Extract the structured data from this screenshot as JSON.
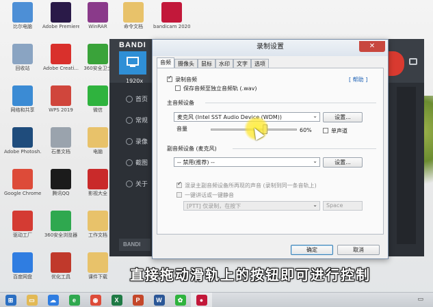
{
  "desktop": {
    "icons": [
      {
        "label": "比尔电脑",
        "icon": "computer-icon",
        "color": "#4d8fd6"
      },
      {
        "label": "Adobe Premiere...",
        "icon": "premiere-icon",
        "color": "#2a1a48"
      },
      {
        "label": "WinRAR",
        "icon": "winrar-icon",
        "color": "#8a3a8a"
      },
      {
        "label": "命令文档",
        "icon": "folder-icon",
        "color": "#e8c26a"
      },
      {
        "label": "bandicam 2020-03-0...",
        "icon": "video-file-icon",
        "color": "#c2183a"
      },
      {
        "label": "回收站",
        "icon": "recycle-bin-icon",
        "color": "#8aa4c2"
      },
      {
        "label": "Adobe Creati...",
        "icon": "creative-cloud-icon",
        "color": "#d9302c"
      },
      {
        "label": "360安全卫士",
        "icon": "360-security-icon",
        "color": "#3aa33a"
      },
      {
        "label": "网络和共享",
        "icon": "network-icon",
        "color": "#3b8bd4"
      },
      {
        "label": "WPS 2019",
        "icon": "wps-icon",
        "color": "#d0463c"
      },
      {
        "label": "微信",
        "icon": "wechat-icon",
        "color": "#2fb33e"
      },
      {
        "label": "Adobe Photosh...",
        "icon": "photoshop-icon",
        "color": "#1f4c7c"
      },
      {
        "label": "石墨文档",
        "icon": "shimo-doc-icon",
        "color": "#9aa3ad"
      },
      {
        "label": "电脑",
        "icon": "folder-icon",
        "color": "#e8c26a"
      },
      {
        "label": "Google Chrome",
        "icon": "chrome-icon",
        "color": "#dd4b39"
      },
      {
        "label": "腾讯QQ",
        "icon": "qq-icon",
        "color": "#1b1b1b"
      },
      {
        "label": "影视大全",
        "icon": "video-app-icon",
        "color": "#c92a2a"
      },
      {
        "label": "驱动工厂",
        "icon": "tool-icon",
        "color": "#d43b33"
      },
      {
        "label": "360安全浏览器",
        "icon": "360-browser-icon",
        "color": "#2fa84f"
      },
      {
        "label": "工作文档",
        "icon": "folder-icon",
        "color": "#e8c26a"
      },
      {
        "label": "百度网盘",
        "icon": "baidu-netdisk-icon",
        "color": "#2f7de1"
      },
      {
        "label": "优化工具",
        "icon": "app-icon",
        "color": "#c0392b"
      },
      {
        "label": "课件下载",
        "icon": "folder-icon",
        "color": "#e8c26a"
      }
    ]
  },
  "bandicam": {
    "brand": "BANDI",
    "resolution": "1920x",
    "side_items": [
      "首页",
      "常规",
      "录像",
      "截图",
      "关于"
    ],
    "bottom_label": "BANDI"
  },
  "dialog": {
    "title": "录制设置",
    "close_glyph": "✕",
    "tabs": [
      "音频",
      "摄像头",
      "鼠标",
      "水印",
      "文字",
      "选项"
    ],
    "active_tab": "音频",
    "record_audio": {
      "label": "录制音频",
      "checked": true
    },
    "separate_track": {
      "label": "保存音频至独立音频轨 (.wav)",
      "checked": false
    },
    "help_link": "[ 帮助 ]",
    "main_device": {
      "group_label": "主音频设备",
      "value": "麦克风 (Intel SST Audio Device (WDM))",
      "settings_button": "设置...",
      "volume_label": "音量",
      "volume_value": "60%",
      "volume_fraction": 0.6,
      "mono_label": "单声道",
      "mono_checked": false
    },
    "secondary_device": {
      "group_label": "副音频设备 (麦克风)",
      "value": "-- 禁用(推荐) --",
      "settings_button": "设置..."
    },
    "mix_option": {
      "label": "混录主副音频设备所再现的声音 (录制到同一条音轨上)",
      "checked": true
    },
    "ptt_option": {
      "label": "一键讲话或一键静音",
      "checked": false
    },
    "ptt_mode": "[PTT] 仅录制，在按下",
    "ptt_key": "Space",
    "ok_button": "确定",
    "cancel_button": "取消"
  },
  "caption": "直接拖动滑轨上的按钮即可进行控制",
  "taskbar": {
    "apps": [
      {
        "icon": "windows-start-icon",
        "glyph": "⊞",
        "color": "#2b6fc2"
      },
      {
        "icon": "file-explorer-icon",
        "glyph": "▭",
        "color": "#e2b955"
      },
      {
        "icon": "baidu-netdisk-icon",
        "glyph": "☁",
        "color": "#2f7de1"
      },
      {
        "icon": "360-browser-icon",
        "glyph": "e",
        "color": "#2fa84f"
      },
      {
        "icon": "chrome-icon",
        "glyph": "◉",
        "color": "#dd4b39"
      },
      {
        "icon": "excel-icon",
        "glyph": "X",
        "color": "#1f7a45"
      },
      {
        "icon": "powerpoint-icon",
        "glyph": "P",
        "color": "#c4472a"
      },
      {
        "icon": "word-icon",
        "glyph": "W",
        "color": "#2b5797"
      },
      {
        "icon": "wechat-icon",
        "glyph": "✿",
        "color": "#2fb33e"
      },
      {
        "icon": "bandicam-icon",
        "glyph": "●",
        "color": "#c2183a"
      }
    ],
    "tray_glyph": "▭"
  }
}
